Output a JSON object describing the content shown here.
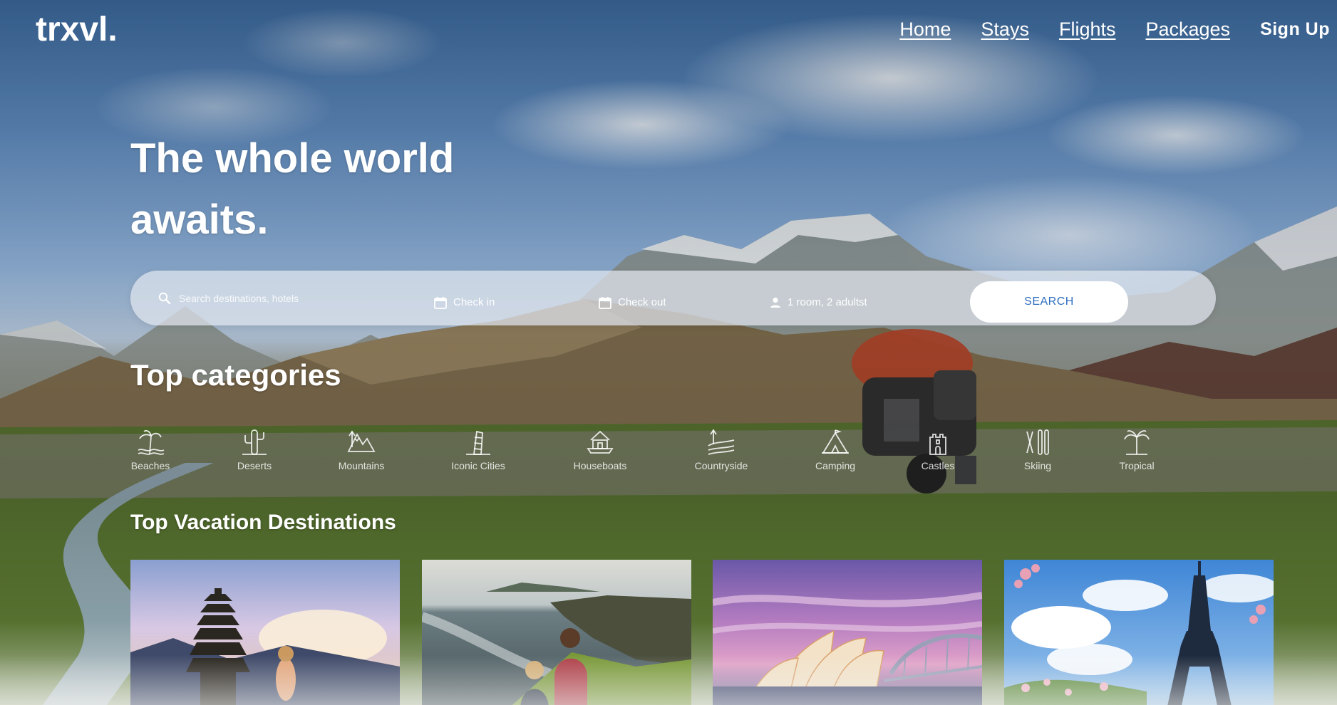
{
  "brand": {
    "logo": "trxvl."
  },
  "nav": {
    "home": "Home",
    "stays": "Stays",
    "flights": "Flights",
    "packages": "Packages",
    "signup": "Sign Up"
  },
  "hero": {
    "title": "The whole world awaits."
  },
  "search": {
    "placeholder": "Search destinations, hotels",
    "check_in": "Check in",
    "check_out": "Check out",
    "guests": "1 room, 2 adultst",
    "button": "SEARCH"
  },
  "categories": {
    "title": "Top categories",
    "items": [
      {
        "label": "Beaches",
        "icon": "beach-icon"
      },
      {
        "label": "Deserts",
        "icon": "cactus-icon"
      },
      {
        "label": "Mountains",
        "icon": "mountain-icon"
      },
      {
        "label": "Iconic Cities",
        "icon": "tower-icon"
      },
      {
        "label": "Houseboats",
        "icon": "houseboat-icon"
      },
      {
        "label": "Countryside",
        "icon": "countryside-icon"
      },
      {
        "label": "Camping",
        "icon": "tent-icon"
      },
      {
        "label": "Castles",
        "icon": "castle-icon"
      },
      {
        "label": "Skiing",
        "icon": "ski-icon"
      },
      {
        "label": "Tropical",
        "icon": "palm-icon"
      }
    ]
  },
  "destinations": {
    "title": "Top Vacation Destinations",
    "cards": [
      {
        "scene": "bali-temple"
      },
      {
        "scene": "coastal-cliffs"
      },
      {
        "scene": "sydney-opera-house"
      },
      {
        "scene": "eiffel-tower"
      }
    ]
  },
  "colors": {
    "accent": "#2f6fc0",
    "text": "#ffffff"
  }
}
